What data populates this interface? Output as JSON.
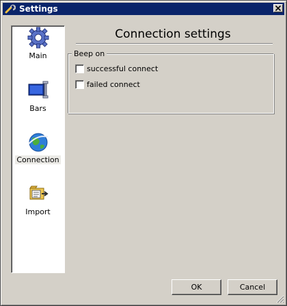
{
  "window": {
    "title": "Settings"
  },
  "sidebar": {
    "items": [
      {
        "label": "Main",
        "icon": "gear-icon",
        "selected": false
      },
      {
        "label": "Bars",
        "icon": "monitor-bars-icon",
        "selected": false
      },
      {
        "label": "Connection",
        "icon": "globe-icon",
        "selected": true
      },
      {
        "label": "Import",
        "icon": "import-icon",
        "selected": false
      }
    ]
  },
  "panel": {
    "title": "Connection settings",
    "group": {
      "legend": "Beep on",
      "options": [
        {
          "label": "successful connect",
          "checked": false
        },
        {
          "label": "failed connect",
          "checked": false
        }
      ]
    }
  },
  "buttons": {
    "ok": "OK",
    "cancel": "Cancel"
  },
  "colors": {
    "titlebar": "#0a246a",
    "face": "#d4d0c8",
    "selection": "#ecebe7"
  }
}
